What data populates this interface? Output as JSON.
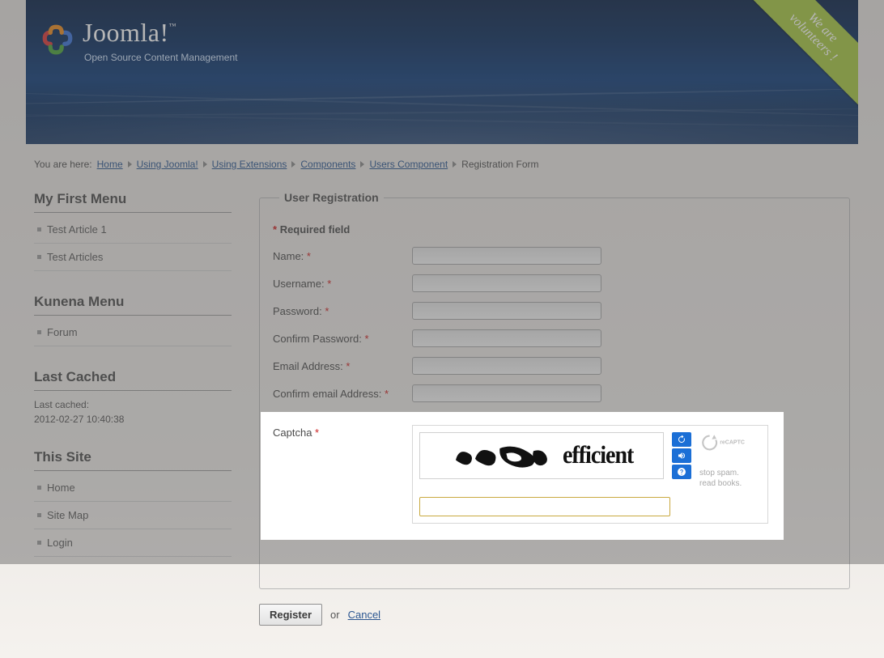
{
  "header": {
    "brand": "Joomla!",
    "tagline": "Open Source Content Management",
    "ribbon_line1": "We are",
    "ribbon_line2": "volunteers !"
  },
  "breadcrumbs": {
    "prefix": "You are here:",
    "items": [
      "Home",
      "Using Joomla!",
      "Using Extensions",
      "Components",
      "Users Component"
    ],
    "current": "Registration Form"
  },
  "sidebar": {
    "menus": [
      {
        "title": "My First Menu",
        "items": [
          "Test Article 1",
          "Test Articles"
        ]
      },
      {
        "title": "Kunena Menu",
        "items": [
          "Forum"
        ]
      }
    ],
    "last_cached": {
      "title": "Last Cached",
      "label": "Last cached:",
      "value": "2012-02-27 10:40:38"
    },
    "this_site": {
      "title": "This Site",
      "items": [
        "Home",
        "Site Map",
        "Login"
      ]
    }
  },
  "form": {
    "legend": "User Registration",
    "required_note": "Required field",
    "fields": {
      "name": "Name:",
      "username": "Username:",
      "password": "Password:",
      "confirm_password": "Confirm Password:",
      "email": "Email Address:",
      "confirm_email": "Confirm email Address:",
      "captcha": "Captcha"
    },
    "captcha": {
      "word2": "efficient",
      "tag1": "stop spam.",
      "tag2": "read books."
    },
    "submit": "Register",
    "or": "or",
    "cancel": "Cancel"
  }
}
